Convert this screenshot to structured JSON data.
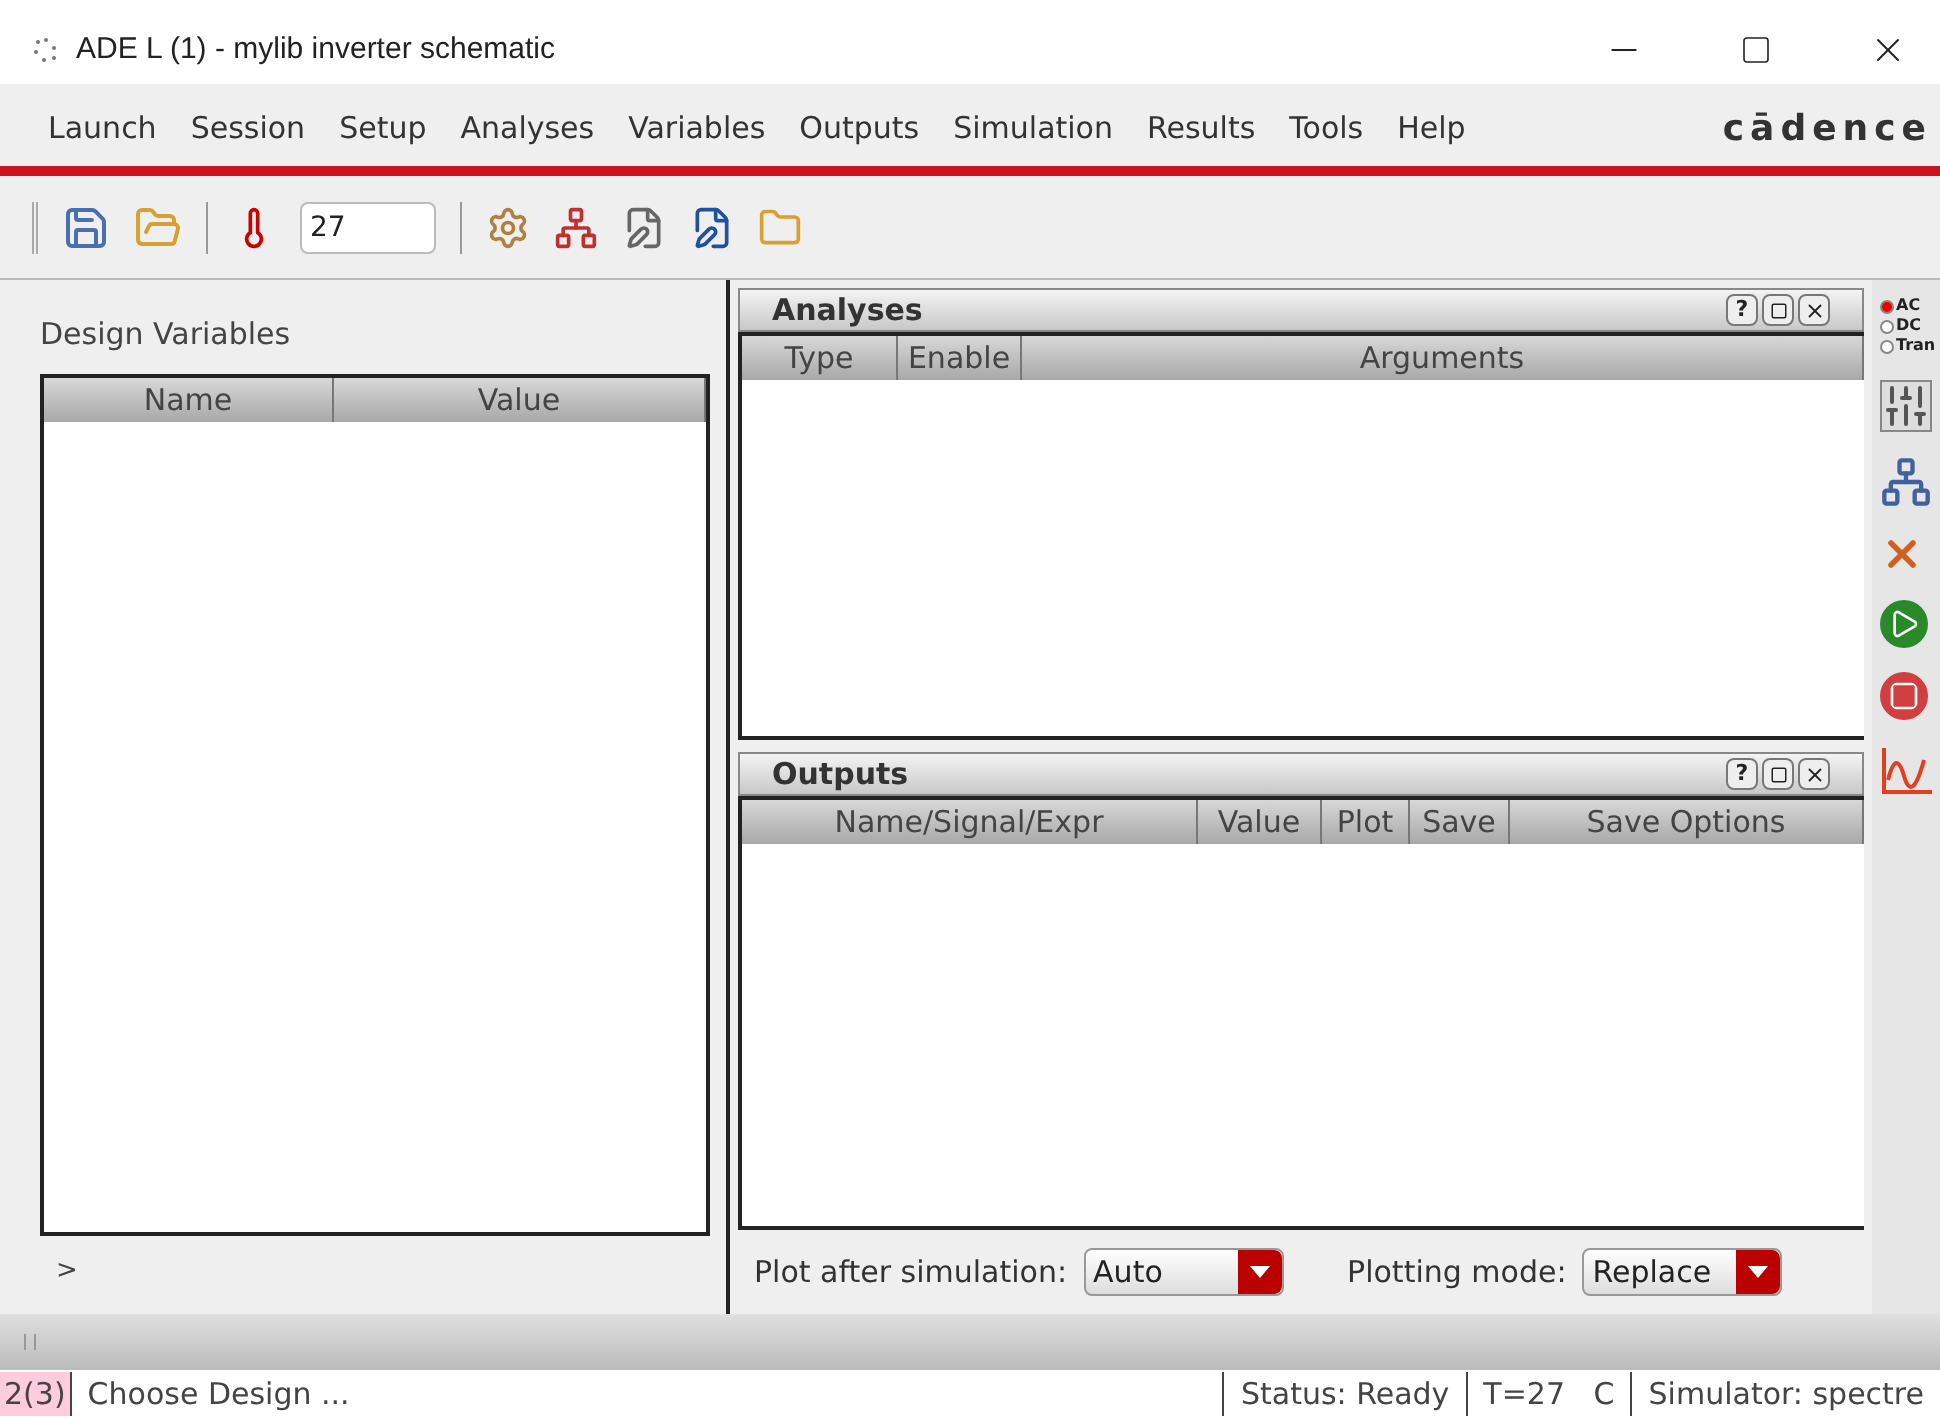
{
  "window": {
    "title": "ADE L (1) - mylib inverter schematic"
  },
  "menu": [
    "Launch",
    "Session",
    "Setup",
    "Analyses",
    "Variables",
    "Outputs",
    "Simulation",
    "Results",
    "Tools",
    "Help"
  ],
  "brand": "cādence",
  "toolbar": {
    "temperature": "27"
  },
  "design_variables": {
    "title": "Design Variables",
    "columns": [
      "Name",
      "Value"
    ],
    "prompt": ">"
  },
  "analyses": {
    "title": "Analyses",
    "help_button": "?",
    "columns": [
      "Type",
      "Enable",
      "Arguments"
    ]
  },
  "outputs": {
    "title": "Outputs",
    "help_button": "?",
    "columns": [
      "Name/Signal/Expr",
      "Value",
      "Plot",
      "Save",
      "Save Options"
    ]
  },
  "plot_after_simulation": {
    "label": "Plot after simulation:",
    "value": "Auto"
  },
  "plotting_mode": {
    "label": "Plotting mode:",
    "value": "Replace"
  },
  "side_radios": [
    {
      "label": "AC",
      "selected": true
    },
    {
      "label": "DC",
      "selected": false
    },
    {
      "label": "Tran",
      "selected": false
    }
  ],
  "status_bar": {
    "counter": "2(3)",
    "message": "Choose Design ...",
    "status": "Status: Ready",
    "temperature": "T=27   C",
    "simulator": "Simulator: spectre"
  }
}
